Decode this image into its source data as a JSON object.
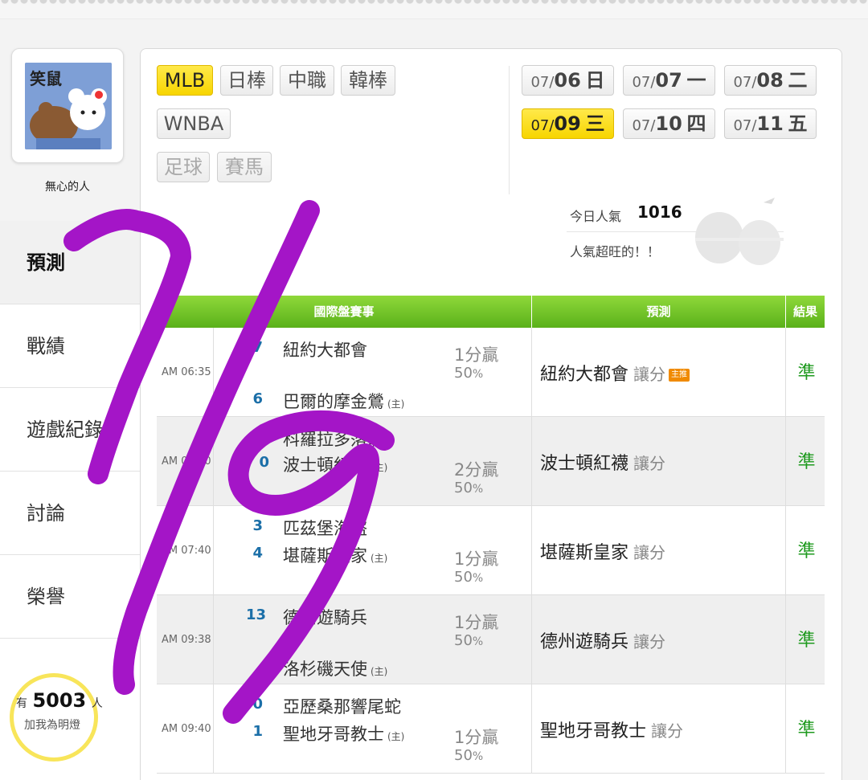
{
  "sidebar": {
    "avatar_caption": "笑鼠",
    "nickname": "無心的人",
    "nav": [
      "預測",
      "戰績",
      "遊戲紀錄",
      "討論",
      "榮譽"
    ],
    "fans_prefix": "有",
    "fans_count": "5003",
    "fans_suffix": "人",
    "fans_cta": "加我為明燈"
  },
  "leagues": [
    "MLB",
    "日棒",
    "中職",
    "韓棒",
    "WNBA",
    "足球",
    "賽馬"
  ],
  "dates": [
    {
      "md": "07/",
      "d": "06",
      "w": "日"
    },
    {
      "md": "07/",
      "d": "07",
      "w": "一"
    },
    {
      "md": "07/",
      "d": "08",
      "w": "二"
    },
    {
      "md": "07/",
      "d": "09",
      "w": "三"
    },
    {
      "md": "07/",
      "d": "10",
      "w": "四"
    },
    {
      "md": "07/",
      "d": "11",
      "w": "五"
    }
  ],
  "popularity": {
    "label": "今日人氣",
    "count": "1016",
    "msg": "人氣超旺的！！"
  },
  "table": {
    "headers": [
      "國際盤賽事",
      "預測",
      "結果"
    ],
    "host_mark": "(主)",
    "badge": "主推",
    "rows": [
      {
        "time": "AM 06:35",
        "s1": "7",
        "t1": "紐約大都會",
        "s2": "6",
        "t2": "巴爾的摩金鶯",
        "spread": "1分贏",
        "pct": "50",
        "pred": "紐約大都會",
        "tag": "讓分",
        "result": "準"
      },
      {
        "time": "AM 07:10",
        "s1": "",
        "t1": "科羅拉多落磯",
        "s2": "0",
        "t2": "波士頓紅襪",
        "spread": "2分贏",
        "pct": "50",
        "pred": "波士頓紅襪",
        "tag": "讓分",
        "result": "準"
      },
      {
        "time": "AM 07:40",
        "s1": "3",
        "t1": "匹茲堡海盜",
        "s2": "4",
        "t2": "堪薩斯皇家",
        "spread": "1分贏",
        "pct": "50",
        "pred": "堪薩斯皇家",
        "tag": "讓分",
        "result": "準"
      },
      {
        "time": "AM 09:38",
        "s1": "13",
        "t1": "德州遊騎兵",
        "s2": "",
        "t2": "洛杉磯天使",
        "spread": "1分贏",
        "pct": "50",
        "pred": "德州遊騎兵",
        "tag": "讓分",
        "result": "準"
      },
      {
        "time": "AM 09:40",
        "s1": "0",
        "t1": "亞歷桑那響尾蛇",
        "s2": "1",
        "t2": "聖地牙哥教士",
        "spread": "1分贏",
        "pct": "50",
        "pred": "聖地牙哥教士",
        "tag": "讓分",
        "result": "準"
      }
    ]
  },
  "colors": {
    "accent_yellow": "#f7d500",
    "header_green": "#5ab11a",
    "result_green": "#1e9a1e",
    "score_blue": "#1b6fa8",
    "scribble_purple": "#a415c7"
  }
}
